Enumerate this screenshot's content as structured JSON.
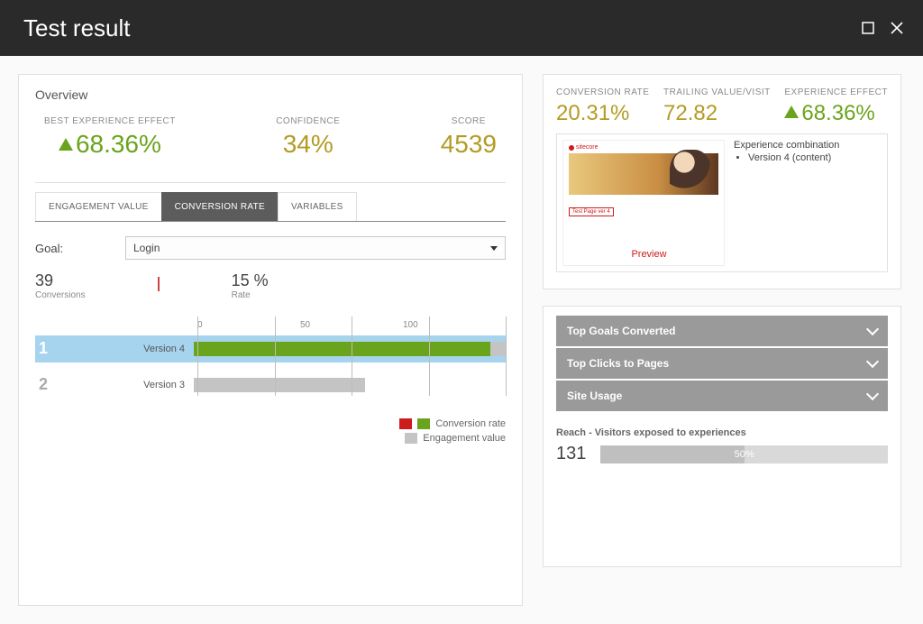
{
  "window": {
    "title": "Test result"
  },
  "overview": {
    "title": "Overview",
    "best_effect": {
      "label": "BEST EXPERIENCE EFFECT",
      "value": "68.36%"
    },
    "confidence": {
      "label": "CONFIDENCE",
      "value": "34%"
    },
    "score": {
      "label": "SCORE",
      "value": "4539"
    }
  },
  "tabs": {
    "engagement": "ENGAGEMENT VALUE",
    "conversion": "CONVERSION RATE",
    "variables": "VARIABLES"
  },
  "goal": {
    "label": "Goal:",
    "selected": "Login"
  },
  "mini": {
    "conversions_value": "39",
    "conversions_label": "Conversions",
    "rate_value": "15 %",
    "rate_label": "Rate"
  },
  "chart_data": {
    "type": "bar",
    "xlim": [
      0,
      100
    ],
    "ticks": [
      "0",
      "50",
      "100"
    ],
    "series": [
      {
        "name": "Conversion rate",
        "color": "#6aa41d"
      },
      {
        "name": "Engagement value",
        "color": "#c4c4c4"
      }
    ],
    "rows": [
      {
        "rank": "1",
        "name": "Version 4",
        "conversion": 95,
        "engagement": 100,
        "highlight": true
      },
      {
        "rank": "2",
        "name": "Version 3",
        "conversion": 0,
        "engagement": 55,
        "highlight": false
      }
    ],
    "legend": {
      "conv": "Conversion rate",
      "eng": "Engagement value"
    }
  },
  "kpi": {
    "conv_rate": {
      "label": "CONVERSION RATE",
      "value": "20.31%"
    },
    "trailing": {
      "label": "TRAILING VALUE/VISIT",
      "value": "72.82"
    },
    "effect": {
      "label": "EXPERIENCE EFFECT",
      "value": "68.36%"
    }
  },
  "preview": {
    "brand": "sitecore",
    "badge": "Test Page ver 4",
    "footer": "",
    "combo_label": "Experience combination",
    "combo_item": "Version 4 (content)",
    "link": "Preview"
  },
  "accordion": {
    "goals": "Top Goals Converted",
    "clicks": "Top Clicks to Pages",
    "usage": "Site Usage"
  },
  "reach": {
    "title": "Reach - Visitors exposed to experiences",
    "value": "131",
    "percent": "50%",
    "fill": 50
  }
}
